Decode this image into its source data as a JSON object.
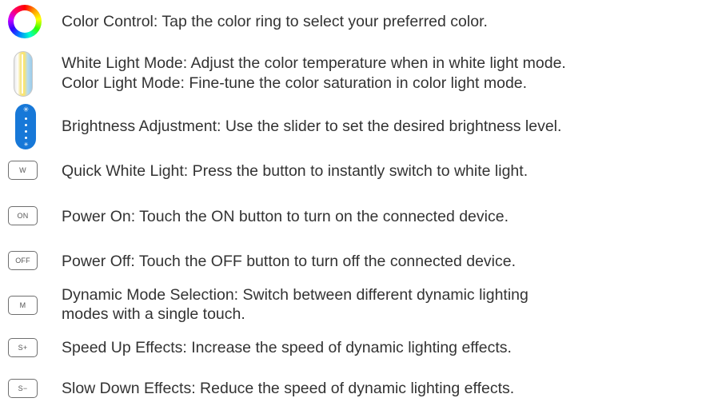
{
  "items": [
    {
      "icon": "color-ring-icon",
      "text": "Color Control: Tap the color ring to select your preferred color."
    },
    {
      "icon": "color-temperature-bar-icon",
      "text": "White Light Mode: Adjust the color temperature when in white light mode."
    },
    {
      "icon": "color-temperature-bar-icon",
      "text": "Color Light Mode: Fine-tune the color saturation in color light mode."
    },
    {
      "icon": "brightness-slider-icon",
      "text": "Brightness Adjustment: Use the slider to set the desired brightness level."
    },
    {
      "icon": "key-w-icon",
      "key_label": "W",
      "text": "Quick White Light: Press the button to instantly switch to white light."
    },
    {
      "icon": "key-on-icon",
      "key_label": "ON",
      "text": "Power On: Touch the ON button to turn on the connected device."
    },
    {
      "icon": "key-off-icon",
      "key_label": "OFF",
      "text": "Power Off: Touch the OFF button to turn off the connected device."
    },
    {
      "icon": "key-m-icon",
      "key_label": "M",
      "text": "Dynamic Mode Selection: Switch between different dynamic lighting",
      "text2": "modes with a single touch."
    },
    {
      "icon": "key-speed-up-icon",
      "key_label": "S+",
      "text": "Speed Up Effects: Increase the speed of dynamic lighting effects."
    },
    {
      "icon": "key-slow-down-icon",
      "key_label": "S−",
      "text": "Slow Down Effects: Reduce the speed of dynamic lighting effects."
    }
  ],
  "colors": {
    "text": "#333333",
    "brightness_bar": "#1778d8",
    "key_border": "#6f6f6f"
  }
}
